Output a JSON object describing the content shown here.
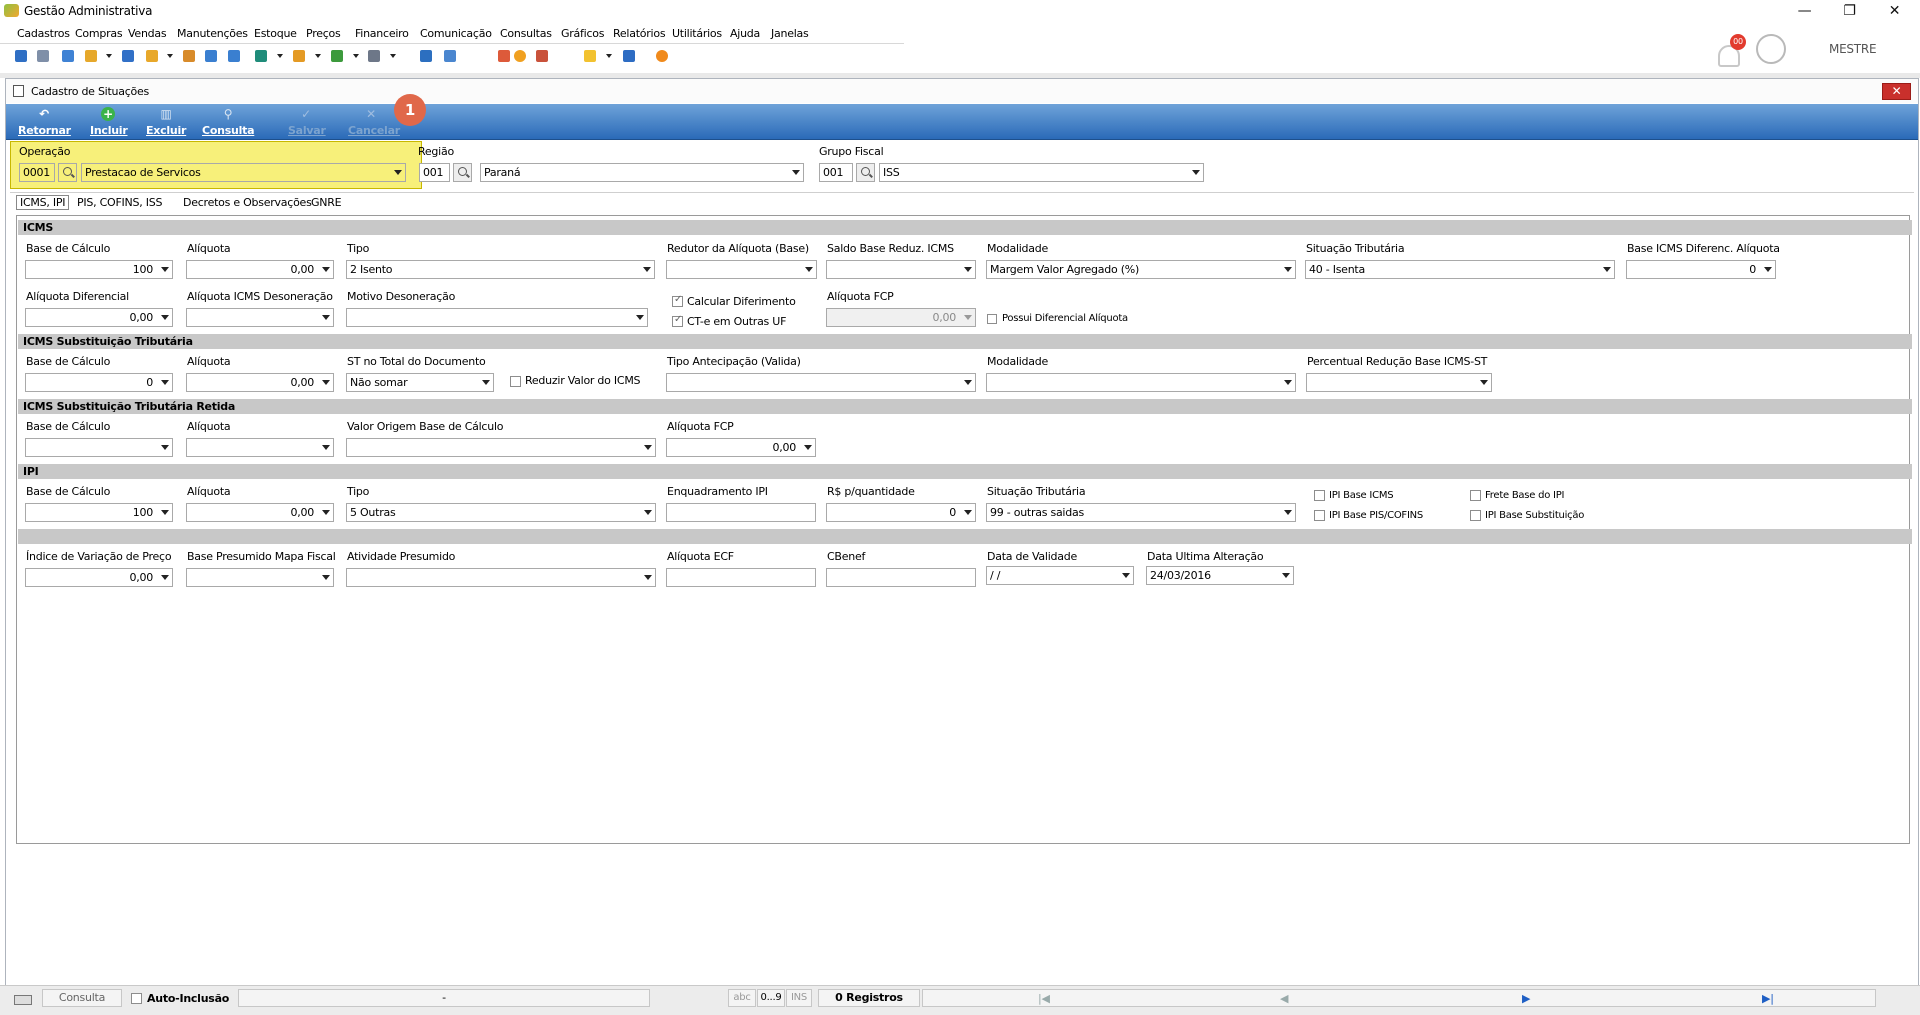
{
  "app": {
    "title": "Gestão Administrativa",
    "user": "MESTRE",
    "badge": "00"
  },
  "menu": [
    "Cadastros",
    "Compras",
    "Vendas",
    "Manutenções",
    "Estoque",
    "Preços",
    "Financeiro",
    "Comunicação",
    "Consultas",
    "Gráficos",
    "Relatórios",
    "Utilitários",
    "Ajuda",
    "Janelas"
  ],
  "window": {
    "title": "Cadastro de Situações"
  },
  "ribbon": {
    "retornar": "Retornar",
    "incluir": "Incluir",
    "excluir": "Excluir",
    "consulta": "Consulta",
    "salvar": "Salvar",
    "cancelar": "Cancelar",
    "step": "1"
  },
  "header": {
    "operacao_label": "Operação",
    "operacao_code": "0001",
    "operacao_value": "Prestacao de Servicos",
    "regiao_label": "Região",
    "regiao_code": "001",
    "regiao_value": "Paraná",
    "grupo_label": "Grupo Fiscal",
    "grupo_code": "001",
    "grupo_value": "ISS"
  },
  "tabs": [
    "ICMS, IPI",
    "PIS, COFINS, ISS",
    "Decretos e Observações",
    "GNRE"
  ],
  "icms": {
    "section": "ICMS",
    "base_label": "Base de Cálculo",
    "base_value": "100",
    "aliq_label": "Alíquota",
    "aliq_value": "0,00",
    "tipo_label": "Tipo",
    "tipo_value": "2 Isento",
    "redutor_label": "Redutor da Alíquota (Base)",
    "saldo_label": "Saldo Base Reduz. ICMS",
    "modalidade_label": "Modalidade",
    "modalidade_value": "Margem Valor Agregado (%)",
    "situacao_label": "Situação Tributária",
    "situacao_value": "40 - Isenta",
    "baseicms_label": "Base ICMS Diferenc. Alíquota",
    "baseicms_value": "0",
    "aliqdif_label": "Alíquota Diferencial",
    "aliqdif_value": "0,00",
    "aliqdeson_label": "Alíquota ICMS Desoneração",
    "motivo_label": "Motivo Desoneração",
    "calc_dif": "Calcular Diferimento",
    "cte": "CT-e em Outras UF",
    "fcp_label": "Alíquota FCP",
    "fcp_value": "0,00",
    "possui": "Possui Diferencial Alíquota"
  },
  "st": {
    "section": "ICMS Substituição Tributária",
    "base_label": "Base de Cálculo",
    "base_value": "0",
    "aliq_label": "Alíquota",
    "aliq_value": "0,00",
    "total_label": "ST no Total do Documento",
    "total_value": "Não somar",
    "reduzir": "Reduzir Valor do ICMS",
    "tipoant_label": "Tipo Antecipação (Valida)",
    "modalidade_label": "Modalidade",
    "percentual_label": "Percentual Redução Base ICMS-ST"
  },
  "stret": {
    "section": "ICMS Substituição Tributária Retida",
    "base_label": "Base de Cálculo",
    "aliq_label": "Alíquota",
    "origem_label": "Valor Origem Base de Cálculo",
    "fcp_label": "Alíquota FCP",
    "fcp_value": "0,00"
  },
  "ipi": {
    "section": "IPI",
    "base_label": "Base de Cálculo",
    "base_value": "100",
    "aliq_label": "Alíquota",
    "aliq_value": "0,00",
    "tipo_label": "Tipo",
    "tipo_value": "5 Outras",
    "enq_label": "Enquadramento IPI",
    "rs_label": "R$ p/quantidade",
    "rs_value": "0",
    "situacao_label": "Situação Tributária",
    "situacao_value": "99 - outras saidas",
    "base_icms": "IPI Base ICMS",
    "frete": "Frete Base do IPI",
    "base_pis": "IPI Base PIS/COFINS",
    "base_subst": "IPI Base Substituição"
  },
  "extra": {
    "indice_label": "Índice de Variação de Preço",
    "indice_value": "0,00",
    "basepres_label": "Base Presumido Mapa Fiscal",
    "ativ_label": "Atividade Presumido",
    "ecf_label": "Alíquota ECF",
    "cbenef_label": "CBenef",
    "validade_label": "Data de Validade",
    "validade_value": " /  /",
    "ultima_label": "Data Ultima Alteração",
    "ultima_value": "24/03/2016"
  },
  "status": {
    "consulta": "Consulta",
    "auto": "Auto-Inclusão",
    "dash": "-",
    "abc": "abc",
    "num": "0...9",
    "ins": "INS",
    "registros": "0 Registros"
  }
}
